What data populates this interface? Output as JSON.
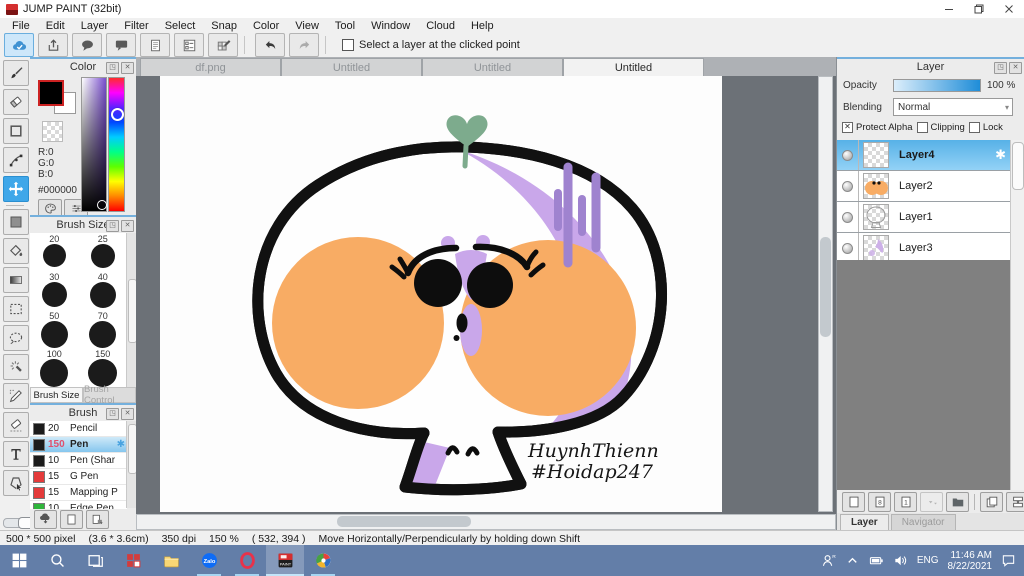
{
  "window": {
    "title": "JUMP PAINT (32bit)",
    "controls": [
      "minimize-icon",
      "maximize-icon",
      "close-icon"
    ]
  },
  "menu": {
    "items": [
      "File",
      "Edit",
      "Layer",
      "Filter",
      "Select",
      "Snap",
      "Color",
      "View",
      "Tool",
      "Window",
      "Cloud",
      "Help"
    ]
  },
  "toolbar": {
    "buttons": [
      {
        "name": "cloud-sync",
        "selected": true
      },
      {
        "name": "publish",
        "selected": false
      },
      {
        "name": "comment",
        "selected": false
      },
      {
        "name": "comment-box",
        "selected": false
      },
      {
        "name": "document",
        "selected": false
      },
      {
        "name": "material-panel",
        "selected": false
      },
      {
        "name": "palette-edit",
        "selected": false
      }
    ],
    "history": [
      {
        "name": "undo",
        "enabled": true
      },
      {
        "name": "redo",
        "enabled": false
      }
    ],
    "checkbox_label": "Select a layer at the clicked point",
    "checkbox_checked": false
  },
  "toolstrip": {
    "tools": [
      {
        "name": "brush",
        "selected": false
      },
      {
        "name": "eraser",
        "selected": false
      },
      {
        "name": "shape-brush",
        "selected": false
      },
      {
        "name": "control-point",
        "selected": false
      },
      {
        "name": "move",
        "selected": true
      },
      {
        "name": "fill-rect",
        "selected": false
      },
      {
        "name": "bucket",
        "selected": false
      },
      {
        "name": "gradient",
        "selected": false
      },
      {
        "name": "select-rect",
        "selected": false
      },
      {
        "name": "select-lasso",
        "selected": false
      },
      {
        "name": "magic-wand",
        "selected": false
      },
      {
        "name": "select-pen",
        "selected": false
      },
      {
        "name": "select-eraser",
        "selected": false
      },
      {
        "name": "text",
        "selected": false
      },
      {
        "name": "object-select",
        "selected": false
      }
    ]
  },
  "color_panel": {
    "title": "Color",
    "r_label": "R:0",
    "g_label": "G:0",
    "b_label": "B:0",
    "hex": "#000000",
    "foreground": "#000000",
    "background": "#ffffff",
    "buttons": [
      "palette",
      "sliders"
    ]
  },
  "brush_size_panel": {
    "title": "Brush Size",
    "sizes": [
      "20",
      "25",
      "30",
      "40",
      "50",
      "70",
      "100",
      "150"
    ],
    "tabs": [
      {
        "label": "Brush Size",
        "active": true
      },
      {
        "label": "Brush Control",
        "active": false
      }
    ]
  },
  "brush_panel": {
    "title": "Brush",
    "brushes": [
      {
        "size": "20",
        "name": "Pencil",
        "swatch": "#1b1b1b",
        "selected": false
      },
      {
        "size": "150",
        "name": "Pen",
        "swatch": "#1b1b1b",
        "selected": true
      },
      {
        "size": "10",
        "name": "Pen (Shar",
        "swatch": "#1b1b1b",
        "selected": false
      },
      {
        "size": "15",
        "name": "G Pen",
        "swatch": "#e43b3b",
        "selected": false
      },
      {
        "size": "15",
        "name": "Mapping P",
        "swatch": "#e43b3b",
        "selected": false
      },
      {
        "size": "10",
        "name": "Edge Pen",
        "swatch": "#2fb53b",
        "selected": false
      }
    ],
    "footer_buttons": [
      "cloud-dl",
      "new-doc",
      "doc-menu"
    ]
  },
  "canvas": {
    "tabs": [
      {
        "label": "df.png",
        "active": false
      },
      {
        "label": "Untitled",
        "active": false
      },
      {
        "label": "Untitled",
        "active": false
      },
      {
        "label": "Untitled",
        "active": true
      }
    ],
    "signature_line1": "HuynhThienn",
    "signature_line2": "#Hoidap247",
    "artwork_colors": {
      "outline": "#111111",
      "cheeks": "#f8ac64",
      "shading": "#c9a7ea",
      "stress_lines": "#9f83cf",
      "sprout": "#7dab8d"
    }
  },
  "layer_panel": {
    "title": "Layer",
    "opacity_label": "Opacity",
    "opacity_value": "100 %",
    "blending_label": "Blending",
    "blending_value": "Normal",
    "checkboxes": [
      {
        "label": "Protect Alpha",
        "checked": true
      },
      {
        "label": "Clipping",
        "checked": false
      },
      {
        "label": "Lock",
        "checked": false
      }
    ],
    "layers": [
      {
        "name": "Layer4",
        "selected": true,
        "thumb": "blank"
      },
      {
        "name": "Layer2",
        "selected": false,
        "thumb": "face"
      },
      {
        "name": "Layer1",
        "selected": false,
        "thumb": "outline"
      },
      {
        "name": "Layer3",
        "selected": false,
        "thumb": "shade"
      }
    ],
    "buttons": [
      {
        "name": "add-layer",
        "enabled": true
      },
      {
        "name": "add-8bit-layer",
        "enabled": true
      },
      {
        "name": "add-1bit-layer",
        "enabled": true
      },
      {
        "name": "layer-options",
        "enabled": false
      },
      {
        "name": "folder",
        "enabled": true
      },
      {
        "name": "duplicate-layer",
        "enabled": true
      },
      {
        "name": "merge-layer",
        "enabled": true
      }
    ],
    "tabs": [
      {
        "label": "Layer",
        "active": true
      },
      {
        "label": "Navigator",
        "active": false
      }
    ]
  },
  "statusbar": {
    "segments": [
      "500 * 500 pixel",
      "(3.6 * 3.6cm)",
      "350 dpi",
      "150 %",
      "( 532, 394 )",
      "Move Horizontally/Perpendicularly by holding down Shift"
    ]
  },
  "taskbar": {
    "apps": [
      {
        "name": "start",
        "running": false,
        "active": false
      },
      {
        "name": "search",
        "running": false,
        "active": false
      },
      {
        "name": "task-view",
        "running": false,
        "active": false
      },
      {
        "name": "remote-app",
        "running": false,
        "active": false
      },
      {
        "name": "file-explorer",
        "running": false,
        "active": false
      },
      {
        "name": "zalo",
        "running": true,
        "active": false
      },
      {
        "name": "opera",
        "running": true,
        "active": false
      },
      {
        "name": "jump-paint",
        "running": true,
        "active": true
      },
      {
        "name": "medibang",
        "running": true,
        "active": false
      }
    ],
    "tray": {
      "icons": [
        "people",
        "chevron-up",
        "battery",
        "speaker"
      ],
      "language": "ENG",
      "time": "11:46 AM",
      "date": "8/22/2021",
      "notification_icon": "notification"
    }
  }
}
